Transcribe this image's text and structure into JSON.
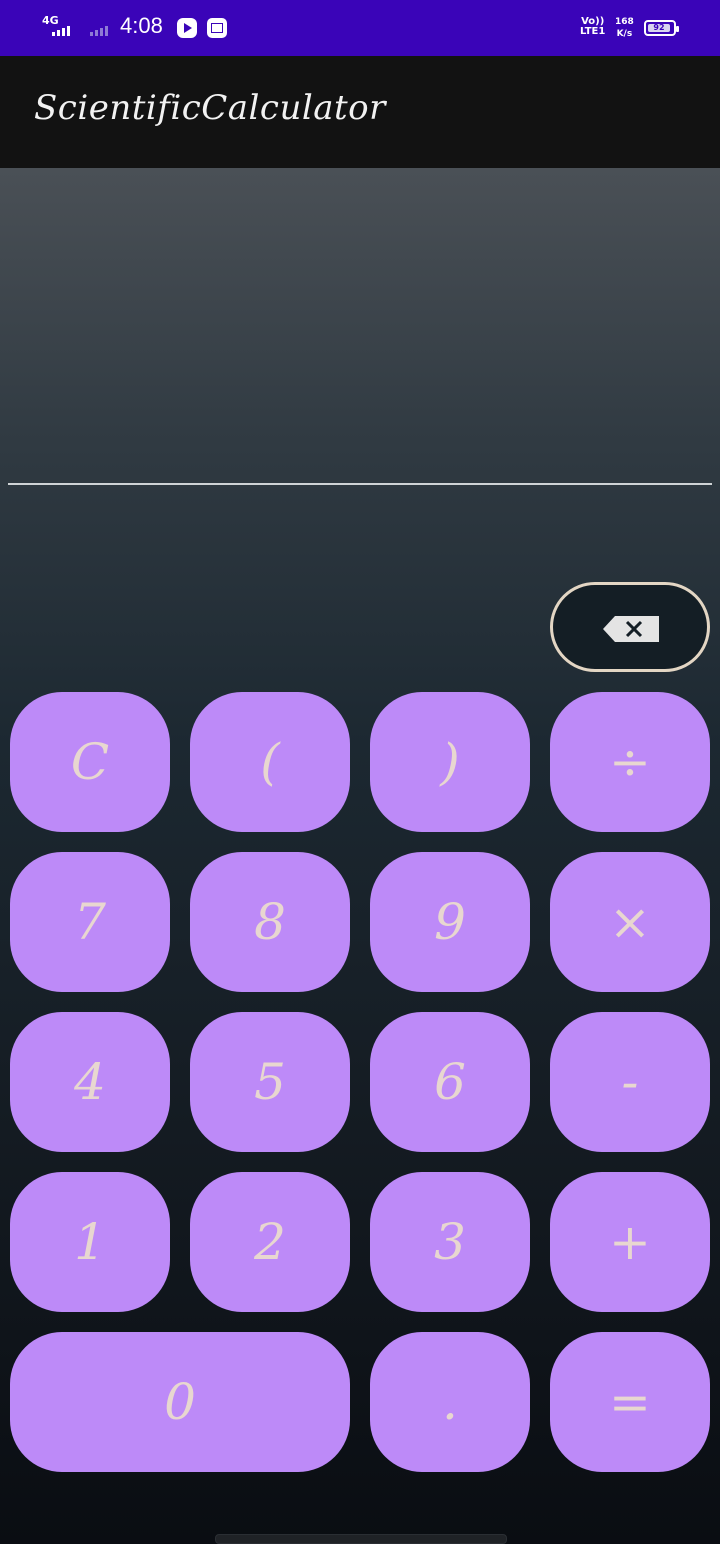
{
  "status_bar": {
    "network": "4G",
    "time": "4:08",
    "volte_top": "Vo))",
    "volte_bottom": "LTE1",
    "speed_value": "168",
    "speed_unit": "K/s",
    "battery": "92"
  },
  "app_bar": {
    "title": "ScientificCalculator"
  },
  "display": {
    "expression": ""
  },
  "colors": {
    "status_bar": "#3a04b8",
    "app_bar": "#121212",
    "key_background": "#bd8af8",
    "key_text": "#e8d7d0",
    "backspace_border": "#e3d6c4"
  },
  "backspace": {
    "icon": "backspace-icon"
  },
  "keys": {
    "clear": "C",
    "paren_open": "(",
    "paren_close": ")",
    "divide": "÷",
    "seven": "7",
    "eight": "8",
    "nine": "9",
    "multiply": "×",
    "four": "4",
    "five": "5",
    "six": "6",
    "minus": "-",
    "one": "1",
    "two": "2",
    "three": "3",
    "plus": "+",
    "zero": "0",
    "dot": ".",
    "equals": "="
  }
}
